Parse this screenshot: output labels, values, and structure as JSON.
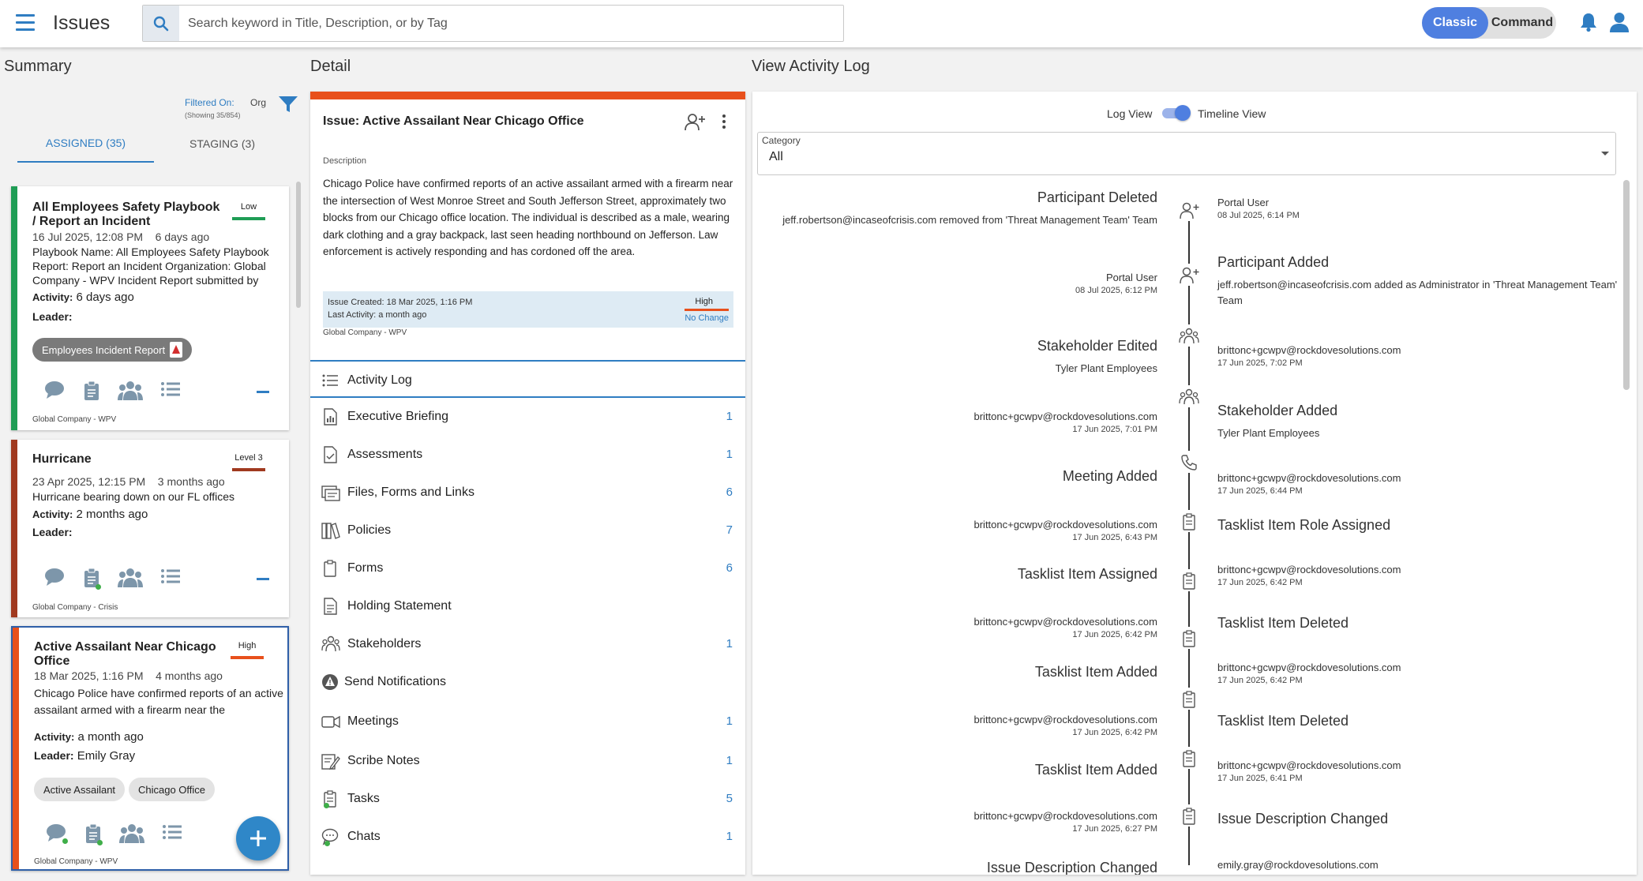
{
  "header": {
    "title": "Issues",
    "search_placeholder": "Search keyword in Title, Description, or by Tag",
    "toggle_classic": "Classic",
    "toggle_command": "Command"
  },
  "summary": {
    "title": "Summary",
    "filter_label": "Filtered On:",
    "filter_value": "Org",
    "filter_count": "(Showing 35/854)",
    "tab_assigned": "ASSIGNED (35)",
    "tab_staging": "STAGING (3)",
    "cards": [
      {
        "title": "All Employees Safety Playbook / Report an Incident",
        "priority": "Low",
        "priority_color": "#1f9d55",
        "bar_color": "#1f9d55",
        "date": "16 Jul 2025, 12:08 PM",
        "ago": "6 days ago",
        "description": "Playbook Name: All Employees Safety Playbook Report: Report an Incident Organization: Global Company - WPV Incident Report submitted by",
        "activity_label": "Activity:",
        "activity": "6 days ago",
        "leader_label": "Leader:",
        "leader": "",
        "tags": [
          "Employees Incident Report"
        ],
        "org": "Global Company - WPV"
      },
      {
        "title": "Hurricane",
        "priority": "Level 3",
        "priority_color": "#a0391f",
        "bar_color": "#a0391f",
        "date": "23 Apr 2025, 12:15 PM",
        "ago": "3 months ago",
        "description": "Hurricane bearing down on our FL offices",
        "activity_label": "Activity:",
        "activity": "2 months ago",
        "leader_label": "Leader:",
        "leader": "",
        "tags": [],
        "org": "Global Company - Crisis"
      },
      {
        "title": "Active Assailant Near Chicago Office",
        "priority": "High",
        "priority_color": "#e8501c",
        "bar_color": "#e8501c",
        "date": "18 Mar 2025, 1:16 PM",
        "ago": "4 months ago",
        "description": "Chicago Police have confirmed reports of an active assailant armed with a firearm near the intersection of West Monroe Street and South",
        "activity_label": "Activity:",
        "activity": "a month ago",
        "leader_label": "Leader:",
        "leader": "Emily Gray",
        "tags": [
          "Active Assailant",
          "Chicago Office"
        ],
        "org": "Global Company - WPV"
      }
    ]
  },
  "detail": {
    "title": "Detail",
    "issue_title": "Issue: Active Assailant Near Chicago Office",
    "description_label": "Description",
    "description": "Chicago Police have confirmed reports of an active assailant armed with a firearm near the intersection of West Monroe Street and South Jefferson Street, approximately two blocks from our Chicago office location. The individual is described as a male, wearing dark clothing and a gray backpack, last seen heading northbound on Jefferson. Law enforcement is actively responding and has cordoned off the area.",
    "issue_created": "Issue Created: 18 Mar 2025, 1:16 PM",
    "last_activity": "Last Activity: a month ago",
    "priority": "High",
    "priority_change": "No Change",
    "org": "Global Company - WPV",
    "menu": [
      {
        "label": "Activity Log",
        "count": "",
        "icon": "list-icon"
      },
      {
        "label": "Executive Briefing",
        "count": "1",
        "icon": "report-doc-icon"
      },
      {
        "label": "Assessments",
        "count": "1",
        "icon": "assessment-doc-icon"
      },
      {
        "label": "Files, Forms and Links",
        "count": "6",
        "icon": "files-icon"
      },
      {
        "label": "Policies",
        "count": "7",
        "icon": "policies-book-icon"
      },
      {
        "label": "Forms",
        "count": "6",
        "icon": "clipboard-icon"
      },
      {
        "label": "Holding Statement",
        "count": "",
        "icon": "statement-doc-icon"
      },
      {
        "label": "Stakeholders",
        "count": "1",
        "icon": "stakeholders-icon"
      },
      {
        "label": "Send Notifications",
        "count": "",
        "icon": "notification-alert-icon"
      },
      {
        "label": "Meetings",
        "count": "1",
        "icon": "video-camera-icon"
      },
      {
        "label": "Scribe Notes",
        "count": "1",
        "icon": "notes-pen-icon"
      },
      {
        "label": "Tasks",
        "count": "5",
        "icon": "tasks-clipboard-icon"
      },
      {
        "label": "Chats",
        "count": "1",
        "icon": "chat-bubble-icon"
      }
    ]
  },
  "log": {
    "title": "View Activity Log",
    "log_view_label": "Log View",
    "timeline_view_label": "Timeline View",
    "category_label": "Category",
    "category_value": "All",
    "events": [
      {
        "side": "left",
        "title": "Participant Deleted",
        "detail": "jeff.robertson@incaseofcrisis.com removed from 'Threat Management Team' Team",
        "user": "Portal User",
        "time": "08 Jul 2025, 6:14 PM",
        "icon": "add-person-icon"
      },
      {
        "side": "right",
        "title": "Participant Added",
        "detail": "jeff.robertson@incaseofcrisis.com added as Administrator in 'Threat Management Team' Team",
        "user": "Portal User",
        "time": "08 Jul 2025, 6:12 PM",
        "icon": "add-person-icon"
      },
      {
        "side": "left",
        "title": "Stakeholder Edited",
        "detail": "Tyler Plant Employees",
        "user": "brittonc+gcwpv@rockdovesolutions.com",
        "time": "17 Jun 2025, 7:02 PM",
        "icon": "stakeholders-icon"
      },
      {
        "side": "right",
        "title": "Stakeholder Added",
        "detail": "Tyler Plant Employees",
        "user": "brittonc+gcwpv@rockdovesolutions.com",
        "time": "17 Jun 2025, 7:01 PM",
        "icon": "stakeholders-icon"
      },
      {
        "side": "left",
        "title": "Meeting Added",
        "detail": "",
        "user": "brittonc+gcwpv@rockdovesolutions.com",
        "time": "17 Jun 2025, 6:44 PM",
        "icon": "phone-icon"
      },
      {
        "side": "right",
        "title": "Tasklist Item Role Assigned",
        "detail": "",
        "user": "brittonc+gcwpv@rockdovesolutions.com",
        "time": "17 Jun 2025, 6:43 PM",
        "icon": "clipboard-icon"
      },
      {
        "side": "left",
        "title": "Tasklist Item Assigned",
        "detail": "",
        "user": "brittonc+gcwpv@rockdovesolutions.com",
        "time": "17 Jun 2025, 6:42 PM",
        "icon": "clipboard-icon"
      },
      {
        "side": "right",
        "title": "Tasklist Item Deleted",
        "detail": "",
        "user": "brittonc+gcwpv@rockdovesolutions.com",
        "time": "17 Jun 2025, 6:42 PM",
        "icon": "clipboard-icon"
      },
      {
        "side": "left",
        "title": "Tasklist Item Added",
        "detail": "",
        "user": "brittonc+gcwpv@rockdovesolutions.com",
        "time": "17 Jun 2025, 6:42 PM",
        "icon": "clipboard-icon"
      },
      {
        "side": "right",
        "title": "Tasklist Item Deleted",
        "detail": "",
        "user": "brittonc+gcwpv@rockdovesolutions.com",
        "time": "17 Jun 2025, 6:42 PM",
        "icon": "clipboard-icon"
      },
      {
        "side": "left",
        "title": "Tasklist Item Added",
        "detail": "",
        "user": "brittonc+gcwpv@rockdovesolutions.com",
        "time": "17 Jun 2025, 6:41 PM",
        "icon": "clipboard-icon"
      },
      {
        "side": "right",
        "title": "Issue Description Changed",
        "detail": "",
        "user": "brittonc+gcwpv@rockdovesolutions.com",
        "time": "17 Jun 2025, 6:27 PM",
        "icon": "dash-icon"
      },
      {
        "side": "left",
        "title": "Issue Description Changed",
        "detail": "",
        "user": "emily.gray@rockdovesolutions.com",
        "time": "",
        "icon": "dash-icon"
      }
    ]
  },
  "colors": {
    "accent": "#2f7dc2",
    "high": "#e8501c",
    "low": "#1f9d55",
    "level3": "#a0391f"
  }
}
